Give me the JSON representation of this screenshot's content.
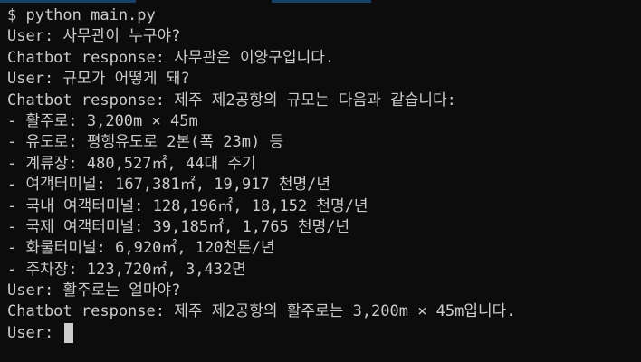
{
  "terminal": {
    "colors": {
      "background": "#0c0c0c",
      "foreground": "#cccccc",
      "cursor": "#cccccc"
    },
    "command": "$ python main.py",
    "lines": [
      "User: 사무관이 누구야?",
      "Chatbot response: 사무관은 이양구입니다.",
      "User: 규모가 어떻게 돼?",
      "Chatbot response: 제주 제2공항의 규모는 다음과 같습니다:",
      "- 활주로: 3,200m × 45m",
      "- 유도로: 평행유도로 2본(폭 23m) 등",
      "- 계류장: 480,527㎡, 44대 주기",
      "- 여객터미널: 167,381㎡, 19,917 천명/년",
      "- 국내 여객터미널: 128,196㎡, 18,152 천명/년",
      "- 국제 여객터미널: 39,185㎡, 1,765 천명/년",
      "- 화물터미널: 6,920㎡, 120천톤/년",
      "- 주차장: 123,720㎡, 3,432면",
      "User: 활주로는 얼마야?",
      "Chatbot response: 제주 제2공항의 활주로는 3,200m × 45m입니다."
    ],
    "prompt": "User: "
  }
}
